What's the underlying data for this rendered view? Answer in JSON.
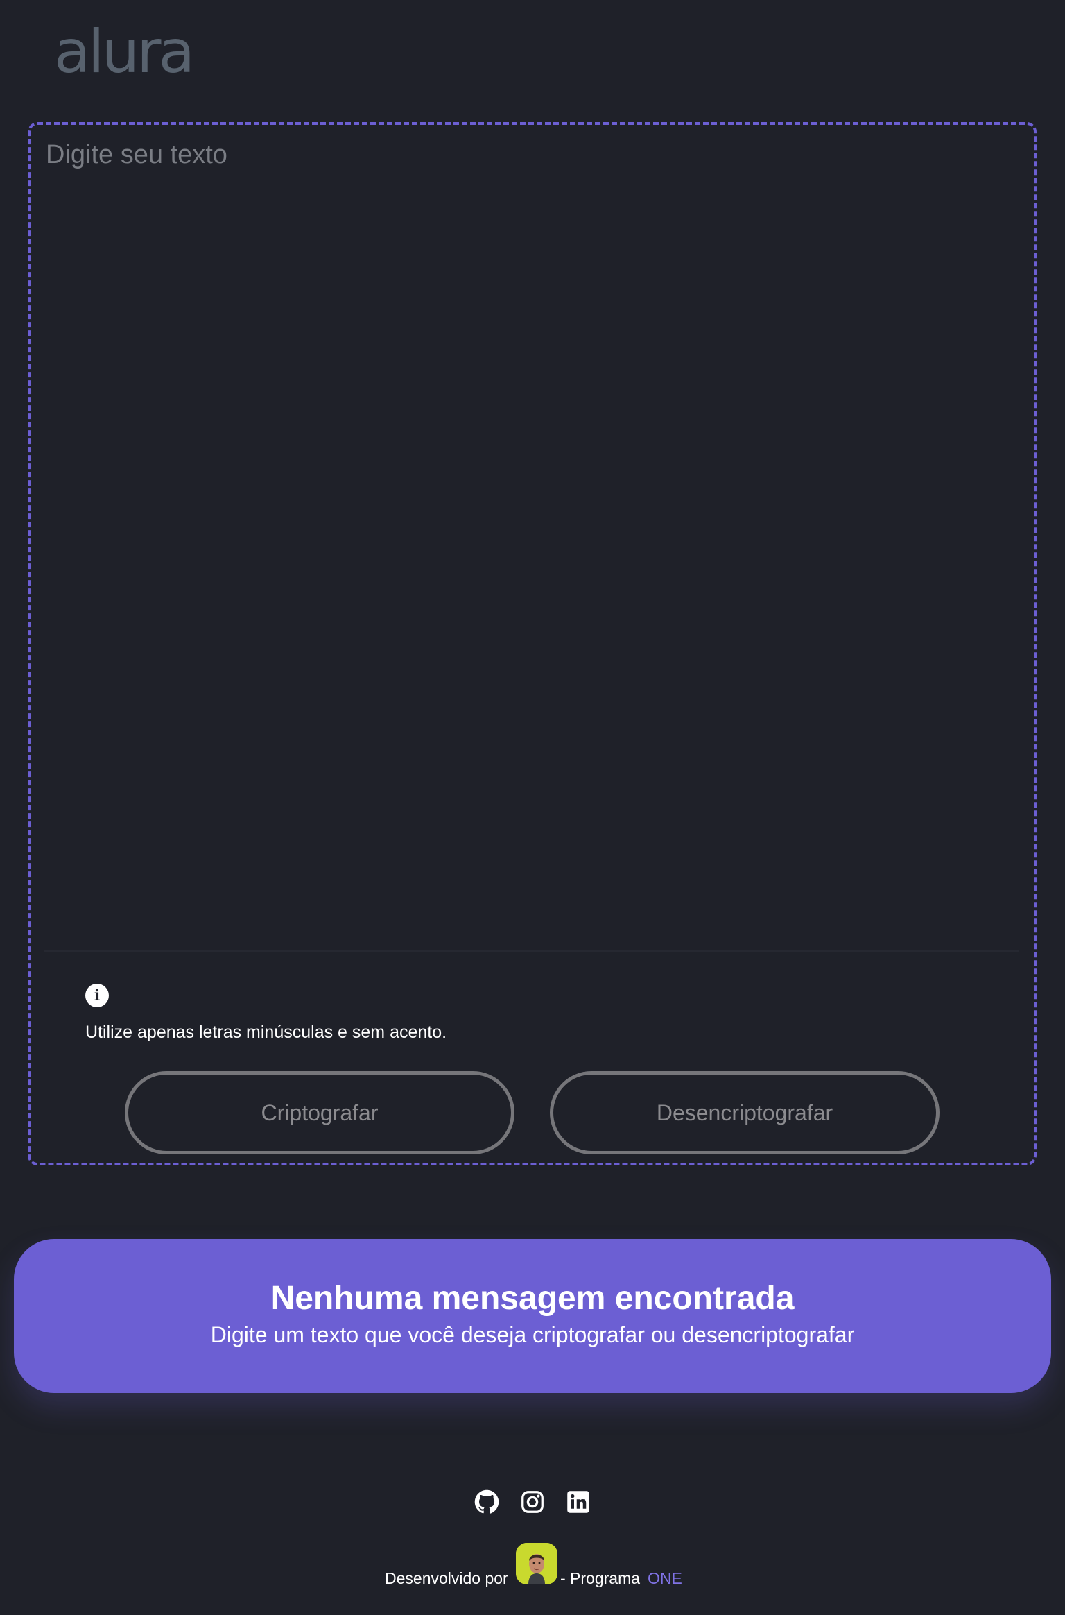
{
  "header": {
    "logo_text": "alura"
  },
  "input": {
    "placeholder": "Digite seu texto",
    "value": ""
  },
  "info": {
    "icon": "info-icon",
    "hint": "Utilize apenas letras minúsculas e sem acento."
  },
  "buttons": {
    "encrypt_label": "Criptografar",
    "decrypt_label": "Desencriptografar"
  },
  "result": {
    "title": "Nenhuma mensagem encontrada",
    "subtitle": "Digite um texto que você deseja criptografar ou desencriptografar"
  },
  "footer": {
    "social_icons": [
      "github-icon",
      "instagram-icon",
      "linkedin-icon"
    ],
    "credits_prefix": "Desenvolvido por",
    "credits_middle": "- Programa",
    "credits_accent": "ONE"
  },
  "colors": {
    "background": "#1f2129",
    "accent": "#6c5fd3",
    "logo": "#58626e",
    "button_border": "#76767a"
  }
}
